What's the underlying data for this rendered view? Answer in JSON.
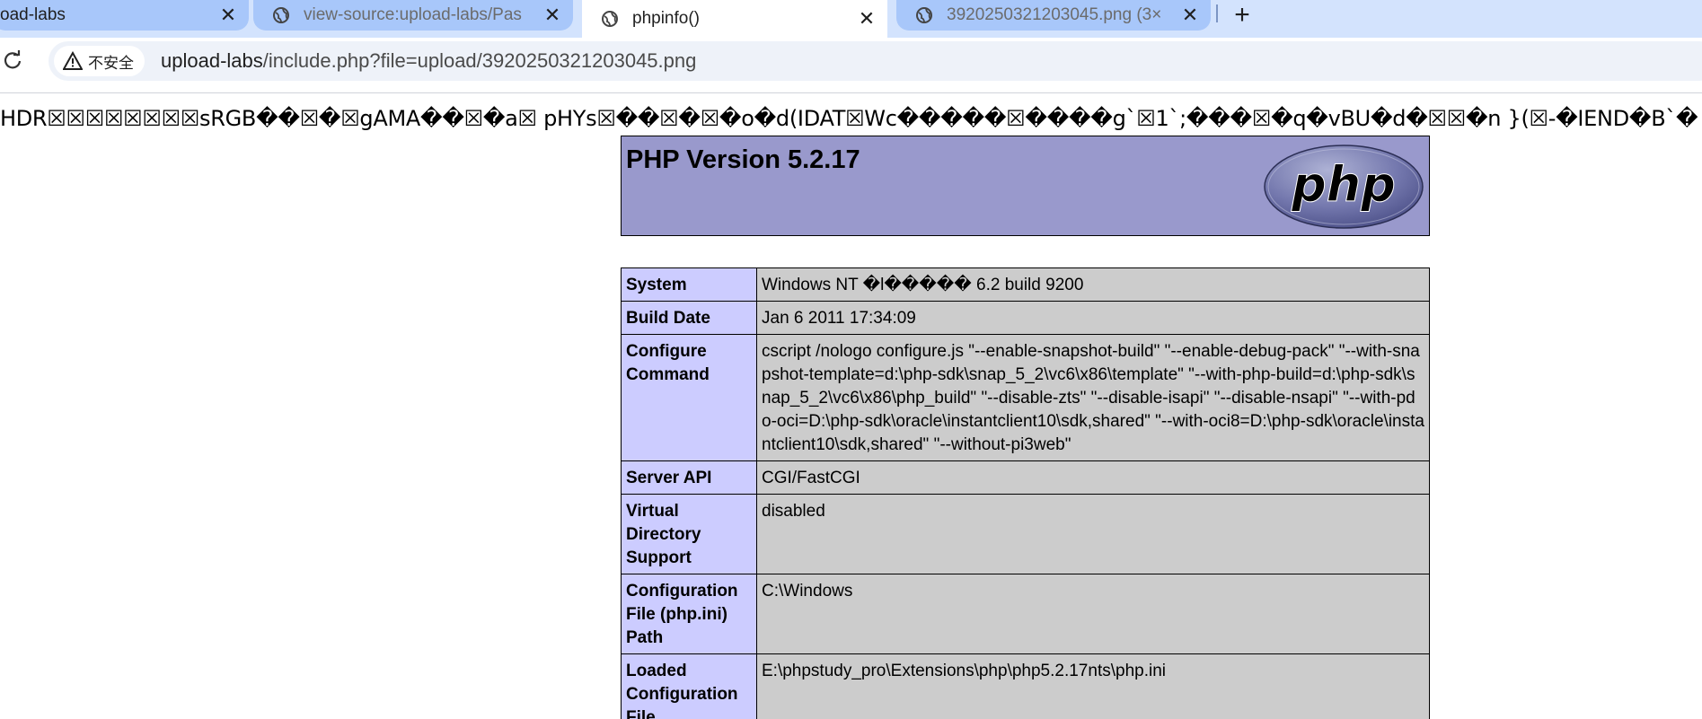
{
  "browser": {
    "tabs": [
      {
        "title": "oad-labs",
        "close": "✕"
      },
      {
        "title": "view-source:upload-labs/Pas",
        "close": "✕"
      },
      {
        "title": "phpinfo()",
        "close": "✕"
      },
      {
        "title": "3920250321203045.png (3×",
        "close": "✕"
      }
    ],
    "new_tab": "+"
  },
  "toolbar": {
    "security_label": "不安全",
    "url_host": "upload-labs",
    "url_path": "/include.php?file=upload/3920250321203045.png"
  },
  "page": {
    "garbage_text": "HDR☒☒☒☒☒☒☒☒sRGB��☒�☒gAMA��☒�a☒ pHYs☒��☒�☒�o�d(IDAT☒Wc�����☒����g`☒1`;���☒�q�vBU�d�☒☒�n }(☒-�IEND�B`�",
    "php_version": "PHP Version 5.2.17",
    "logo_text": "php",
    "rows": [
      {
        "label": "System",
        "value": "Windows NT �l����� 6.2 build 9200"
      },
      {
        "label": "Build Date",
        "value": "Jan 6 2011 17:34:09"
      },
      {
        "label": "Configure Command",
        "value": "cscript /nologo configure.js \"--enable-snapshot-build\" \"--enable-debug-pack\" \"--with-snapshot-template=d:\\php-sdk\\snap_5_2\\vc6\\x86\\template\" \"--with-php-build=d:\\php-sdk\\snap_5_2\\vc6\\x86\\php_build\" \"--disable-zts\" \"--disable-isapi\" \"--disable-nsapi\" \"--with-pdo-oci=D:\\php-sdk\\oracle\\instantclient10\\sdk,shared\" \"--with-oci8=D:\\php-sdk\\oracle\\instantclient10\\sdk,shared\" \"--without-pi3web\""
      },
      {
        "label": "Server API",
        "value": "CGI/FastCGI"
      },
      {
        "label": "Virtual Directory Support",
        "value": "disabled"
      },
      {
        "label": "Configuration File (php.ini) Path",
        "value": "C:\\Windows"
      },
      {
        "label": "Loaded Configuration File",
        "value": "E:\\phpstudy_pro\\Extensions\\php\\php5.2.17nts\\php.ini"
      }
    ]
  },
  "colors": {
    "tabstrip": "#d3e3fd",
    "header": "#9999cc",
    "label_cell": "#ccccff",
    "value_cell": "#cccccc"
  }
}
